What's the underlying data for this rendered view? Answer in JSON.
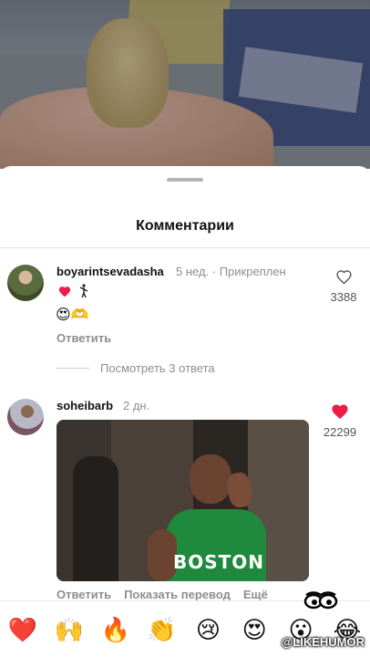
{
  "sheet": {
    "title": "Комментарии"
  },
  "comments": [
    {
      "username": "boyarintsevadasha",
      "meta": "5 нед. · Прикреплен",
      "text_emojis": "😍🫶",
      "like_count": "3388",
      "liked": false,
      "reply_label": "Ответить",
      "view_replies_label": "Посмотреть 3 ответа"
    },
    {
      "username": "soheibarb",
      "meta": "2 дн.",
      "like_count": "22299",
      "liked": true,
      "gif_caption_text": "BOSTON",
      "actions": [
        "Ответить",
        "Показать перевод",
        "Ещё"
      ]
    }
  ],
  "emoji_bar": [
    "❤️",
    "🙌",
    "🔥",
    "👏",
    "😢",
    "😍",
    "😮",
    "😂"
  ],
  "watermark": "@LIKEHUMOR",
  "colors": {
    "like_red": "#ed1d4b",
    "meta_gray": "#8e8e8e"
  }
}
